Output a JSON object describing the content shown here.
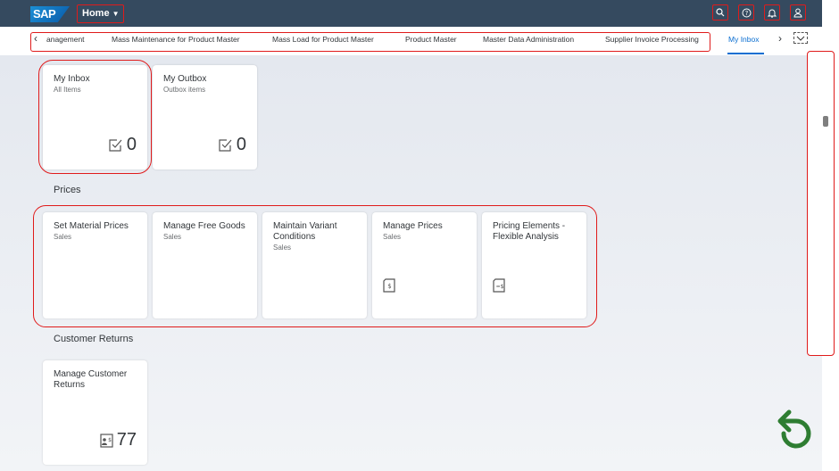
{
  "shell": {
    "logo": "SAP",
    "home_label": "Home"
  },
  "icons": {
    "search": "search-icon",
    "help": "help-icon",
    "notifications": "bell-icon",
    "user": "user-icon"
  },
  "tabs": [
    {
      "label": "anagement"
    },
    {
      "label": "Mass Maintenance for Product Master"
    },
    {
      "label": "Mass Load for Product Master"
    },
    {
      "label": "Product Master"
    },
    {
      "label": "Master Data Administration"
    },
    {
      "label": "Supplier Invoice Processing"
    },
    {
      "label": "My Inbox",
      "active": true
    }
  ],
  "inbox_tiles": [
    {
      "title": "My Inbox",
      "subtitle": "All Items",
      "count": "0"
    },
    {
      "title": "My Outbox",
      "subtitle": "Outbox items",
      "count": "0"
    }
  ],
  "prices": {
    "group_title": "Prices",
    "tiles": [
      {
        "title": "Set Material Prices",
        "subtitle": "Sales"
      },
      {
        "title": "Manage Free Goods",
        "subtitle": "Sales"
      },
      {
        "title": "Maintain Variant Conditions",
        "subtitle": "Sales"
      },
      {
        "title": "Manage Prices",
        "subtitle": "Sales"
      },
      {
        "title": "Pricing Elements - Flexible Analysis",
        "subtitle": ""
      }
    ]
  },
  "returns": {
    "group_title": "Customer Returns",
    "tiles": [
      {
        "title": "Manage Customer Returns",
        "subtitle": "",
        "count": "77"
      }
    ]
  },
  "colors": {
    "shell_bg": "#354a5f",
    "highlight": "#e01b1b",
    "accent": "#0a6ed1",
    "undo": "#2e7d32"
  }
}
